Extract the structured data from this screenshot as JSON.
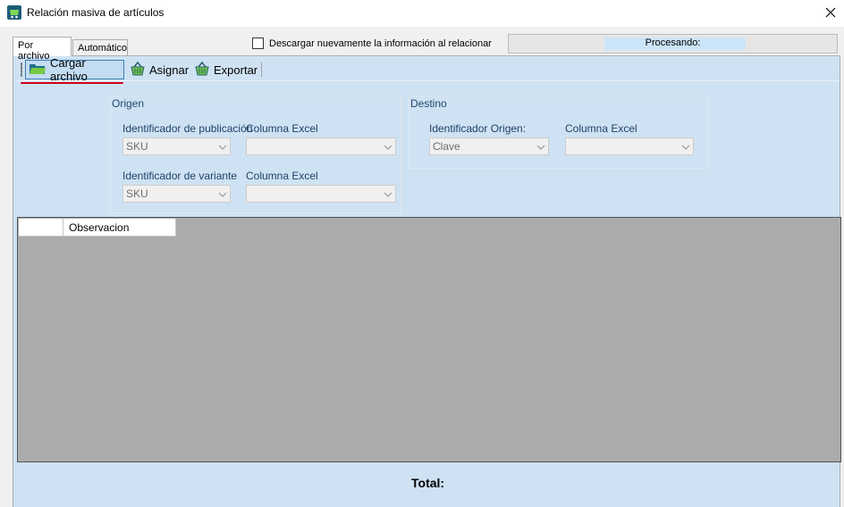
{
  "window": {
    "title": "Relación masiva de artículos"
  },
  "tabs": [
    {
      "label": "Por archivo",
      "active": true
    },
    {
      "label": "Automático",
      "active": false
    }
  ],
  "options": {
    "redownload_checkbox_label": "Descargar nuevamente la información al relacionar",
    "redownload_checked": false
  },
  "status": {
    "label": "Procesando:"
  },
  "toolbar": {
    "load_label": "Cargar archivo",
    "assign_label": "Asignar",
    "export_label": "Exportar",
    "load_icon": "folder-icon",
    "assign_icon": "shopping-basket-icon",
    "export_icon": "shopping-basket-icon"
  },
  "origin": {
    "heading": "Origen",
    "pub_id_label": "Identificador de publicación",
    "pub_id_value": "SKU",
    "pub_excel_label": "Columna Excel",
    "pub_excel_value": "",
    "var_id_label": "Identificador de variante",
    "var_id_value": "SKU",
    "var_excel_label": "Columna Excel",
    "var_excel_value": ""
  },
  "destination": {
    "heading": "Destino",
    "origin_id_label": "Identificador Origen:",
    "origin_id_value": "Clave",
    "excel_label": "Columna Excel",
    "excel_value": ""
  },
  "grid": {
    "columns": [
      "",
      "Observacion"
    ]
  },
  "footer": {
    "total_label": "Total:"
  },
  "colors": {
    "panel_bg": "#cfe2f3",
    "grid_bg": "#ababab",
    "highlight_underline": "#d0021b",
    "progress_fill": "#cce4f7"
  }
}
